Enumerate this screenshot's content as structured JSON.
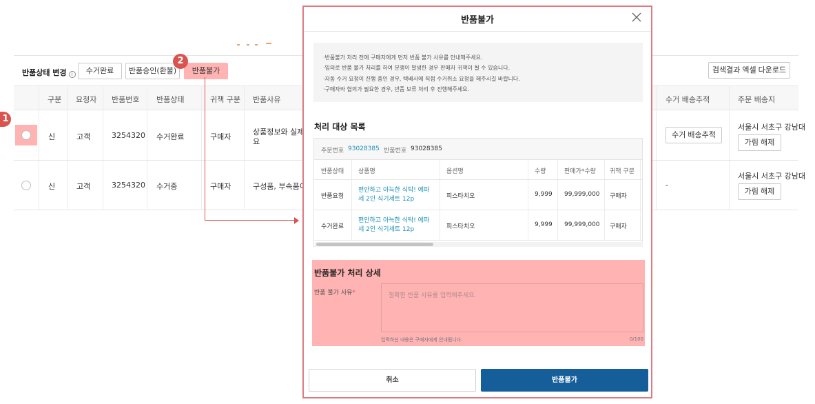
{
  "toolbar": {
    "change_label": "반품상태 변경",
    "info_glyph": "i",
    "btn_collected": "수거완료",
    "btn_approve": "반품승인(환불)",
    "btn_reject": "반품불가",
    "btn_excel": "검색결과 엑셀 다운로드"
  },
  "badges": {
    "one": "1",
    "two": "2"
  },
  "grid": {
    "headers": {
      "type": "구분",
      "requester": "요청자",
      "return_no": "반품번호",
      "status": "반품상태",
      "fault": "귀책 구분",
      "reason": "반품사유",
      "collect_track": "수거 배송추적",
      "ship_addr": "주문 배송지"
    },
    "rows": [
      {
        "type": "신",
        "requester": "고객",
        "return_no": "3254320",
        "status": "수거완료",
        "fault": "구매자",
        "reason_line1": "상품정보와 실제상",
        "reason_line2": "요",
        "track_button": "수거 배송추적",
        "address": "서울시 서초구 강남대",
        "unmask_button": "가림 해제"
      },
      {
        "type": "신",
        "requester": "고객",
        "return_no": "3254320",
        "status": "수거중",
        "fault": "구매자",
        "reason_line1": "구성품, 부속품이 미",
        "track_text": "-",
        "address": "서울시 서초구 강남대",
        "unmask_button": "가림 해제"
      }
    ]
  },
  "modal": {
    "title": "반품불가",
    "close_icon": "close-icon",
    "notices": [
      "·반품불가 처리 전에 구매자에게 먼저 반품 불가 사유를 안내해주세요.",
      "·임의로 반품 불가 처리를 하여 분쟁이 발생한 경우 판매자 귀책이 될 수 있습니다.",
      "·자동 수거 요청이 진행 중인 경우, 택배사에 직접 수거취소 요청을 해주시길 바랍니다.",
      "·구매자와 협의가 필요한 경우, 반품 보류 처리 후 진행해주세요."
    ],
    "target_title": "처리 대상 목록",
    "order_label": "주문번호",
    "order_no": "93028385",
    "return_label": "반품번호",
    "return_no": "93028385",
    "table_headers": {
      "status": "반품상태",
      "product": "상품명",
      "option": "옵션명",
      "qty": "수량",
      "price": "판매가*수량",
      "fault": "귀책 구분"
    },
    "items": [
      {
        "status": "반품요청",
        "product": "편안하고 아늑한 식탁! 에파세 2인 식기세트 12p",
        "option": "피스타치오",
        "qty": "9,999",
        "price": "99,999,000",
        "fault": "구매자"
      },
      {
        "status": "수거완료",
        "product": "편안하고 아늑한 식탁! 에파세 2인 식기세트 12p",
        "option": "피스타치오",
        "qty": "9,999",
        "price": "99,999,000",
        "fault": "구매자"
      }
    ],
    "detail_title": "반품불가 처리 상세",
    "reason_label": "반품 불가 사유",
    "required_mark": "*",
    "reason_placeholder": "정확한 반품 사유를 입력해주세요.",
    "reason_hint": "입력하신 내용은 구매자에게 안내됩니다.",
    "reason_count": "0/100",
    "cancel_button": "취소",
    "confirm_button": "반품불가"
  },
  "colors": {
    "highlight": "#ffb3b3",
    "badge": "#d9534f",
    "primary": "#155e9a",
    "link": "#1a8fb8",
    "modal_border": "#e07a80"
  }
}
